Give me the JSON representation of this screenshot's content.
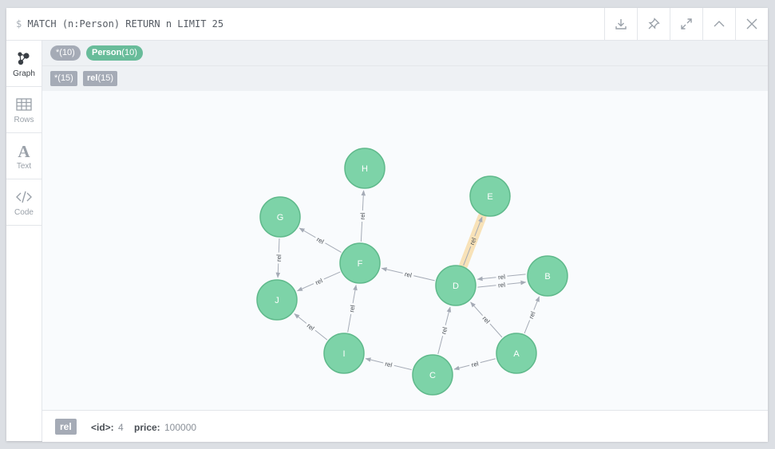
{
  "query": {
    "prompt": "$",
    "text": "MATCH (n:Person) RETURN n LIMIT 25"
  },
  "actions": [
    {
      "name": "download-icon"
    },
    {
      "name": "pin-icon"
    },
    {
      "name": "expand-icon"
    },
    {
      "name": "collapse-icon"
    },
    {
      "name": "close-icon"
    }
  ],
  "sidebar": {
    "items": [
      {
        "label": "Graph",
        "icon": "graph-icon",
        "active": true
      },
      {
        "label": "Rows",
        "icon": "table-icon",
        "active": false
      },
      {
        "label": "Text",
        "icon": "text-icon",
        "active": false
      },
      {
        "label": "Code",
        "icon": "code-icon",
        "active": false
      }
    ]
  },
  "legend": {
    "nodes": [
      {
        "label": "*",
        "count": "(10)"
      },
      {
        "label": "Person",
        "count": "(10)"
      }
    ],
    "relationships": [
      {
        "label": "*",
        "count": "(15)"
      },
      {
        "label": "rel",
        "count": "(15)"
      }
    ]
  },
  "graph": {
    "node_color": "#7dd3a8",
    "node_stroke": "#5fb98b",
    "edge_color": "#a5abb6",
    "highlight_color": "#f8e2b8",
    "nodes": [
      "A",
      "B",
      "C",
      "D",
      "E",
      "F",
      "G",
      "H",
      "I",
      "J"
    ],
    "edges": [
      {
        "from": "D",
        "to": "E",
        "label": "rel",
        "selected": true
      },
      {
        "from": "B",
        "to": "D",
        "label": "rel"
      },
      {
        "from": "D",
        "to": "B",
        "label": "rel"
      },
      {
        "from": "A",
        "to": "B",
        "label": "rel"
      },
      {
        "from": "A",
        "to": "D",
        "label": "rel"
      },
      {
        "from": "A",
        "to": "C",
        "label": "rel"
      },
      {
        "from": "C",
        "to": "D",
        "label": "rel"
      },
      {
        "from": "C",
        "to": "I",
        "label": "rel"
      },
      {
        "from": "D",
        "to": "F",
        "label": "rel"
      },
      {
        "from": "I",
        "to": "F",
        "label": "rel"
      },
      {
        "from": "I",
        "to": "J",
        "label": "rel"
      },
      {
        "from": "F",
        "to": "J",
        "label": "rel"
      },
      {
        "from": "F",
        "to": "G",
        "label": "rel"
      },
      {
        "from": "F",
        "to": "H",
        "label": "rel"
      },
      {
        "from": "G",
        "to": "J",
        "label": "rel"
      }
    ]
  },
  "footer": {
    "type": "rel",
    "props": [
      {
        "key": "<id>:",
        "value": "4"
      },
      {
        "key": "price:",
        "value": "100000"
      }
    ]
  }
}
